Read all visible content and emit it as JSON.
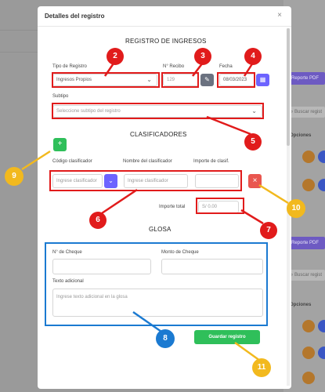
{
  "background": {
    "report_pdf_label": "Reporte PDF",
    "search_placeholder": "Buscar regist",
    "options_header": "Opciones"
  },
  "modal": {
    "title": "Detalles del registro",
    "close_icon": "×"
  },
  "registro": {
    "section_title": "REGISTRO DE INGRESOS",
    "tipo_label": "Tipo de Registro",
    "tipo_value": "Ingresos Propios",
    "recibo_label": "N° Recibo",
    "recibo_value": "129",
    "fecha_label": "Fecha",
    "fecha_value": "08/03/2023",
    "subtipo_label": "Subtipo",
    "subtipo_placeholder": "Seleccione subtipo del registro"
  },
  "clasificadores": {
    "section_title": "CLASIFICADORES",
    "add_button": "+",
    "codigo_label": "Código clasificador",
    "codigo_placeholder": "Ingrese clasificador",
    "nombre_label": "Nombre del clasificador",
    "nombre_placeholder": "Ingrese clasificador",
    "importe_label": "Importe de clasif.",
    "remove_button": "×",
    "importe_total_label": "Importe total",
    "importe_total_value": "S/ 0.00"
  },
  "glosa": {
    "section_title": "GLOSA",
    "cheque_label": "N° de Cheque",
    "monto_label": "Monto de Cheque",
    "texto_label": "Texto adicional",
    "texto_placeholder": "Ingrese texto adicional en la glosa"
  },
  "save_button": "Guardar registro",
  "annotations": [
    "2",
    "3",
    "4",
    "5",
    "6",
    "7",
    "8",
    "9",
    "10",
    "11"
  ],
  "colors": {
    "accent_purple": "#6c63ff",
    "green": "#2fbf5a",
    "red": "#e9564f",
    "annotation_red": "#e11b1b",
    "annotation_blue": "#1b7ad1",
    "annotation_yellow": "#f2b91e"
  },
  "icons": {
    "edit": "pencil-icon",
    "calendar": "calendar-icon",
    "dropdown": "chevron-down-icon"
  }
}
